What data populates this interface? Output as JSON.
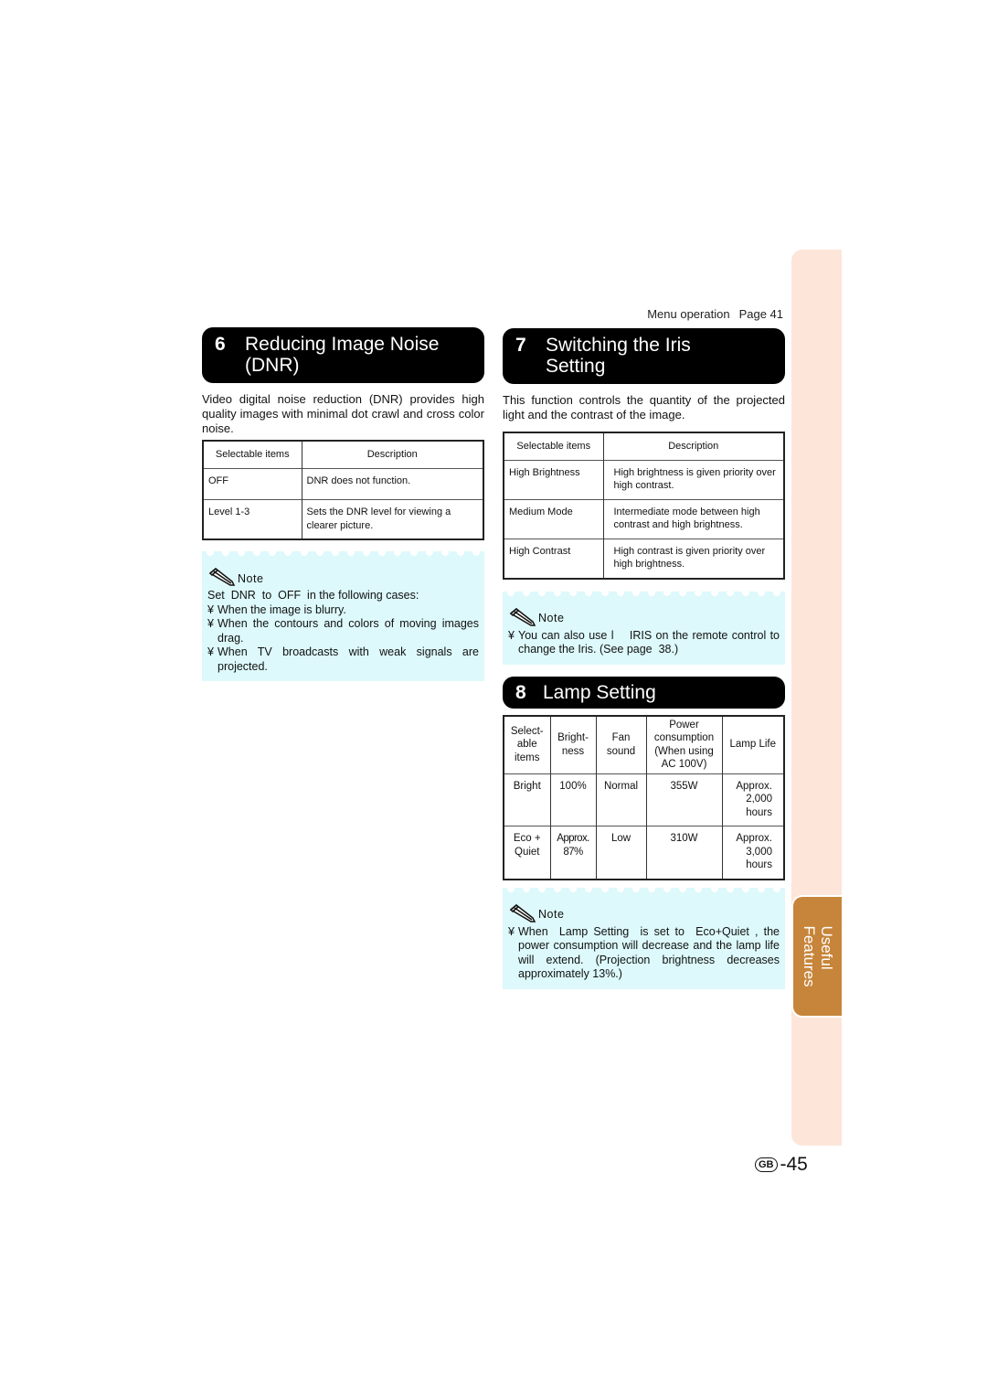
{
  "header": {
    "menu_operation_label": "Menu operation",
    "menu_page_label": "Page 41"
  },
  "section6": {
    "number": "6",
    "title": "Reducing Image Noise (DNR)",
    "intro": "Video digital noise reduction (DNR) provides high quality images with minimal dot crawl and cross color noise.",
    "table": {
      "headers": [
        "Selectable items",
        "Description"
      ],
      "rows": [
        [
          "OFF",
          "DNR does not function."
        ],
        [
          "Level 1-3",
          "Sets the DNR level for viewing a clearer picture."
        ]
      ]
    },
    "note": {
      "label": "Note",
      "lead": "Set  DNR  to  OFF  in the following cases:",
      "bullets": [
        "When the image is blurry.",
        "When the contours and colors of moving images drag.",
        "When TV broadcasts with weak signals are projected."
      ],
      "bullet_mark": "¥"
    }
  },
  "section7": {
    "number": "7",
    "title": "Switching the Iris Setting",
    "intro": "This function controls the quantity of the projected light and the contrast of the image.",
    "table": {
      "headers": [
        "Selectable items",
        "Description"
      ],
      "rows": [
        [
          "High Brightness",
          "High brightness is given priority over high contrast."
        ],
        [
          "Medium Mode",
          "Intermediate mode between high contrast and high brightness."
        ],
        [
          "High Contrast",
          "High contrast is given priority over high brightness."
        ]
      ]
    },
    "note": {
      "label": "Note",
      "bullet_mark": "¥",
      "bullets": [
        "You can also use l    IRIS on the remote control to change the Iris. (See page  38.)"
      ]
    }
  },
  "section8": {
    "number": "8",
    "title": "Lamp Setting",
    "table": {
      "headers": [
        "Select-able items",
        "Bright-ness",
        "Fan sound",
        "Power consumption (When using AC 100V)",
        "Lamp Life"
      ],
      "rows": [
        [
          "Bright",
          "100%",
          "Normal",
          "355W",
          "Approx. 2,000 hours"
        ],
        [
          "Eco + Quiet",
          "Approx. 87%",
          "Low",
          "310W",
          "Approx. 3,000 hours"
        ]
      ]
    },
    "note": {
      "label": "Note",
      "bullet_mark": "¥",
      "bullets": [
        "When  Lamp Setting  is set to  Eco+Quiet , the power consumption will decrease and the lamp life will extend. (Projection brightness decreases approximately 13%.)"
      ]
    }
  },
  "side_tab": {
    "label_line1": "Useful",
    "label_line2": "Features"
  },
  "footer": {
    "region_badge": "GB",
    "page_number": "-45"
  },
  "colors": {
    "heading_bg": "#000000",
    "note_bg": "#ddf9fb",
    "side_strip": "#fde5da",
    "side_tab_active": "#c6853a"
  }
}
